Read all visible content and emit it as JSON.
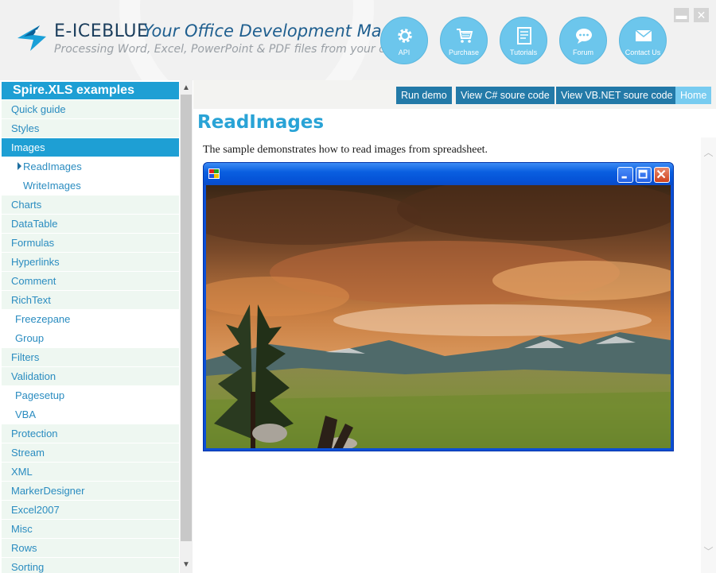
{
  "header": {
    "brand": "E-ICEBLUE",
    "tagline": "Your Office Development Master",
    "subtitle": "Processing Word, Excel, PowerPoint & PDF files from your code",
    "nav": [
      {
        "label": "API",
        "icon": "gear-icon"
      },
      {
        "label": "Purchase",
        "icon": "cart-icon"
      },
      {
        "label": "Tutorials",
        "icon": "document-icon"
      },
      {
        "label": "Forum",
        "icon": "chat-icon"
      },
      {
        "label": "Contact Us",
        "icon": "envelope-icon"
      }
    ],
    "window_controls": {
      "minimize": "▬",
      "close": "✕"
    }
  },
  "sidebar": {
    "title": "Spire.XLS examples",
    "items": [
      {
        "label": "Quick guide"
      },
      {
        "label": "Styles"
      },
      {
        "label": "Images"
      },
      {
        "label": "ReadImages"
      },
      {
        "label": "WriteImages"
      },
      {
        "label": "Charts"
      },
      {
        "label": "DataTable"
      },
      {
        "label": "Formulas"
      },
      {
        "label": "Hyperlinks"
      },
      {
        "label": "Comment"
      },
      {
        "label": "RichText"
      },
      {
        "label": "Freezepane"
      },
      {
        "label": "Group"
      },
      {
        "label": "Filters"
      },
      {
        "label": "Validation"
      },
      {
        "label": "Pagesetup"
      },
      {
        "label": "VBA"
      },
      {
        "label": "Protection"
      },
      {
        "label": "Stream"
      },
      {
        "label": "XML"
      },
      {
        "label": "MarkerDesigner"
      },
      {
        "label": "Excel2007"
      },
      {
        "label": "Misc"
      },
      {
        "label": "Rows"
      },
      {
        "label": "Sorting"
      }
    ],
    "selected": "Images",
    "current": "ReadImages"
  },
  "toolbar": {
    "run_demo": "Run demo",
    "view_csharp": "View C# soure code",
    "view_vbnet": "View VB.NET soure code",
    "home": "Home"
  },
  "content": {
    "title": "ReadImages",
    "description": "The sample demonstrates how to read images from spreadsheet."
  },
  "colors": {
    "accent": "#1e9fd4",
    "toolbar_button": "#237aa8",
    "home_button": "#78ccf0",
    "sidebar_row": "#eef7f1"
  }
}
